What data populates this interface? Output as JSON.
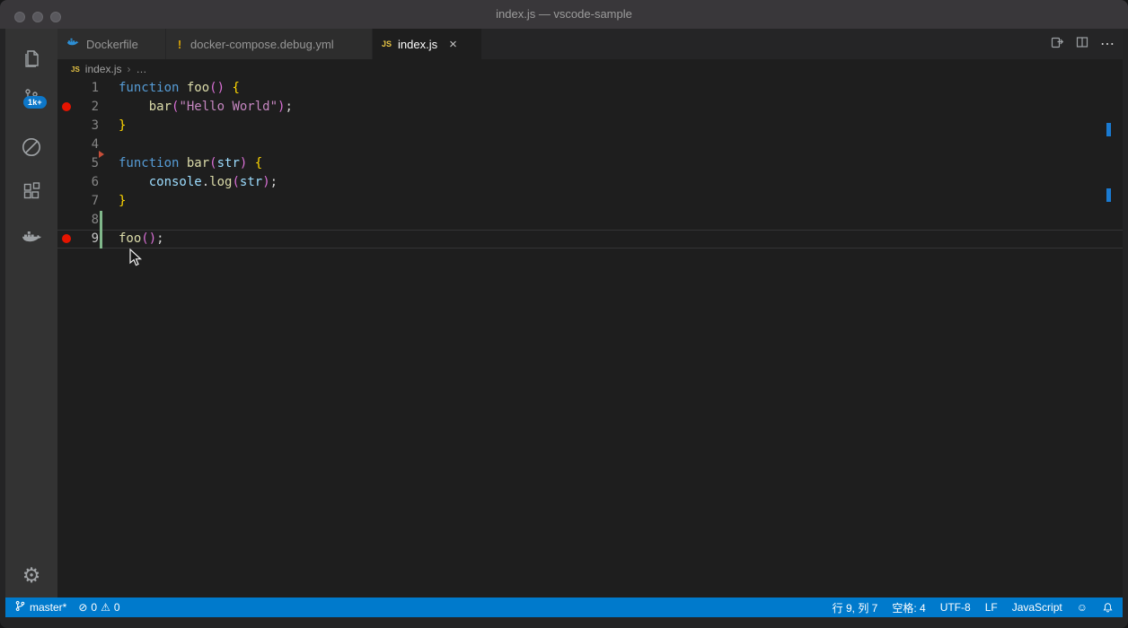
{
  "window": {
    "title": "index.js — vscode-sample"
  },
  "activity_bar": {
    "source_control_badge": "1k+",
    "items": [
      "explorer",
      "source-control",
      "circle-slash",
      "extensions",
      "docker",
      "settings-gear"
    ]
  },
  "tab_bar": {
    "tabs": [
      {
        "label": "Dockerfile",
        "icon": "docker-whale-icon",
        "active": false
      },
      {
        "label": "docker-compose.debug.yml",
        "icon": "exclamation-icon",
        "active": false
      },
      {
        "label": "index.js",
        "icon": "js-file-icon",
        "active": true
      }
    ]
  },
  "editor_actions": [
    "open-changes",
    "split-editor",
    "more-actions"
  ],
  "breadcrumb": {
    "file": "index.js",
    "symbol": "…"
  },
  "icons": {
    "close": "×",
    "more_actions": "⋯",
    "gear": "⚙",
    "error": "⊘",
    "warning": "⚠",
    "feedback": "☺",
    "exclamation": "!",
    "js_badge": "JS",
    "chevron": "›"
  },
  "editor": {
    "current_line": 9,
    "breakpoint_lines": [
      2,
      9
    ],
    "lines": [
      {
        "n": "1",
        "tokens": [
          [
            "kw",
            "function "
          ],
          [
            "fn",
            "foo"
          ],
          [
            "pa",
            "()"
          ],
          [
            "pl",
            " "
          ],
          [
            "br",
            "{"
          ]
        ]
      },
      {
        "n": "2",
        "breakpoint": true,
        "tokens": [
          [
            "pl",
            "    "
          ],
          [
            "fn",
            "bar"
          ],
          [
            "pa",
            "("
          ],
          [
            "str",
            "\"Hello World\""
          ],
          [
            "pa",
            ")"
          ],
          [
            "pl",
            ";"
          ]
        ]
      },
      {
        "n": "3",
        "tokens": [
          [
            "br",
            "}"
          ]
        ]
      },
      {
        "n": "4",
        "tokens": []
      },
      {
        "n": "5",
        "git_deleted_above": true,
        "tokens": [
          [
            "kw",
            "function "
          ],
          [
            "fn",
            "bar"
          ],
          [
            "pa",
            "("
          ],
          [
            "vr",
            "str"
          ],
          [
            "pa",
            ")"
          ],
          [
            "pl",
            " "
          ],
          [
            "br",
            "{"
          ]
        ]
      },
      {
        "n": "6",
        "tokens": [
          [
            "pl",
            "    "
          ],
          [
            "vr",
            "console"
          ],
          [
            "pl",
            "."
          ],
          [
            "fn",
            "log"
          ],
          [
            "pa",
            "("
          ],
          [
            "vr",
            "str"
          ],
          [
            "pa",
            ")"
          ],
          [
            "pl",
            ";"
          ]
        ]
      },
      {
        "n": "7",
        "tokens": [
          [
            "br",
            "}"
          ]
        ]
      },
      {
        "n": "8",
        "git_added": true,
        "tokens": []
      },
      {
        "n": "9",
        "breakpoint": true,
        "git_added": true,
        "current": true,
        "tokens": [
          [
            "fn",
            "foo"
          ],
          [
            "pa",
            "()"
          ],
          [
            "pl",
            ";"
          ]
        ]
      }
    ]
  },
  "status_bar": {
    "branch": "master*",
    "errors": "0",
    "warnings": "0",
    "line_col": "行 9, 列 7",
    "indent": "空格: 4",
    "encoding": "UTF-8",
    "eol": "LF",
    "language": "JavaScript"
  },
  "colors": {
    "status_bar_bg": "#007ACC",
    "badge_bg": "#0d77c9",
    "breakpoint": "#E51400",
    "activity_bar_bg": "#333333",
    "tab_bar_bg": "#252526",
    "editor_bg": "#1E1E1E",
    "keyword": "#569CD6",
    "function": "#DCDCAA",
    "paren": "#DA70D6",
    "brace": "#FFD700",
    "string": "#C586C0",
    "variable": "#9CDCFE",
    "git_added": "#81B88B",
    "git_deleted": "#C74E39",
    "overview_mark": "#1A7AD1"
  }
}
